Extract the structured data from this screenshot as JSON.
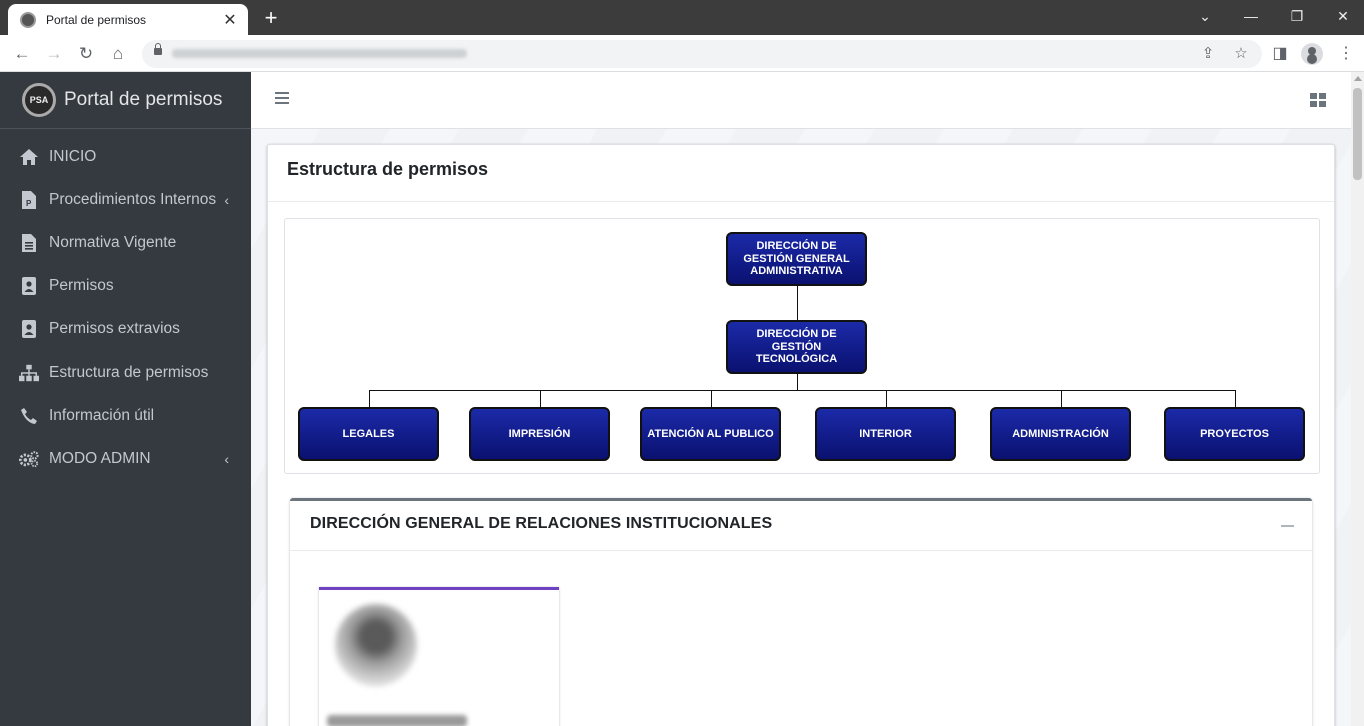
{
  "browser": {
    "tab_title": "Portal de permisos",
    "tab_close": "✕",
    "new_tab": "+"
  },
  "sidebar": {
    "brand_logo": "PSA",
    "brand_title": "Portal de permisos",
    "items": [
      {
        "label": "INICIO",
        "icon": "home-icon"
      },
      {
        "label": "Procedimientos Internos",
        "icon": "file-p-icon",
        "arrow": "‹"
      },
      {
        "label": "Normativa Vigente",
        "icon": "document-icon"
      },
      {
        "label": "Permisos",
        "icon": "id-badge-icon"
      },
      {
        "label": "Permisos extravios",
        "icon": "id-badge-icon"
      },
      {
        "label": "Estructura de permisos",
        "icon": "sitemap-icon"
      },
      {
        "label": "Información útil",
        "icon": "phone-icon"
      },
      {
        "label": "MODO ADMIN",
        "icon": "cogs-icon",
        "arrow": "‹"
      }
    ]
  },
  "main": {
    "page_title": "Estructura de permisos",
    "orgchart": {
      "root": "DIRECCIÓN DE GESTIÓN GENERAL ADMINISTRATIVA",
      "mid": "DIRECCIÓN DE GESTIÓN TECNOLÓGICA",
      "children": [
        "LEGALES",
        "IMPRESIÓN",
        "ATENCIÓN AL PUBLICO",
        "INTERIOR",
        "ADMINISTRACIÓN",
        "PROYECTOS"
      ],
      "node_color": "#0f1a8f"
    },
    "section_title": "DIRECCIÓN GENERAL DE RELACIONES INSTITUCIONALES",
    "accent_color": "#6f42c1"
  }
}
